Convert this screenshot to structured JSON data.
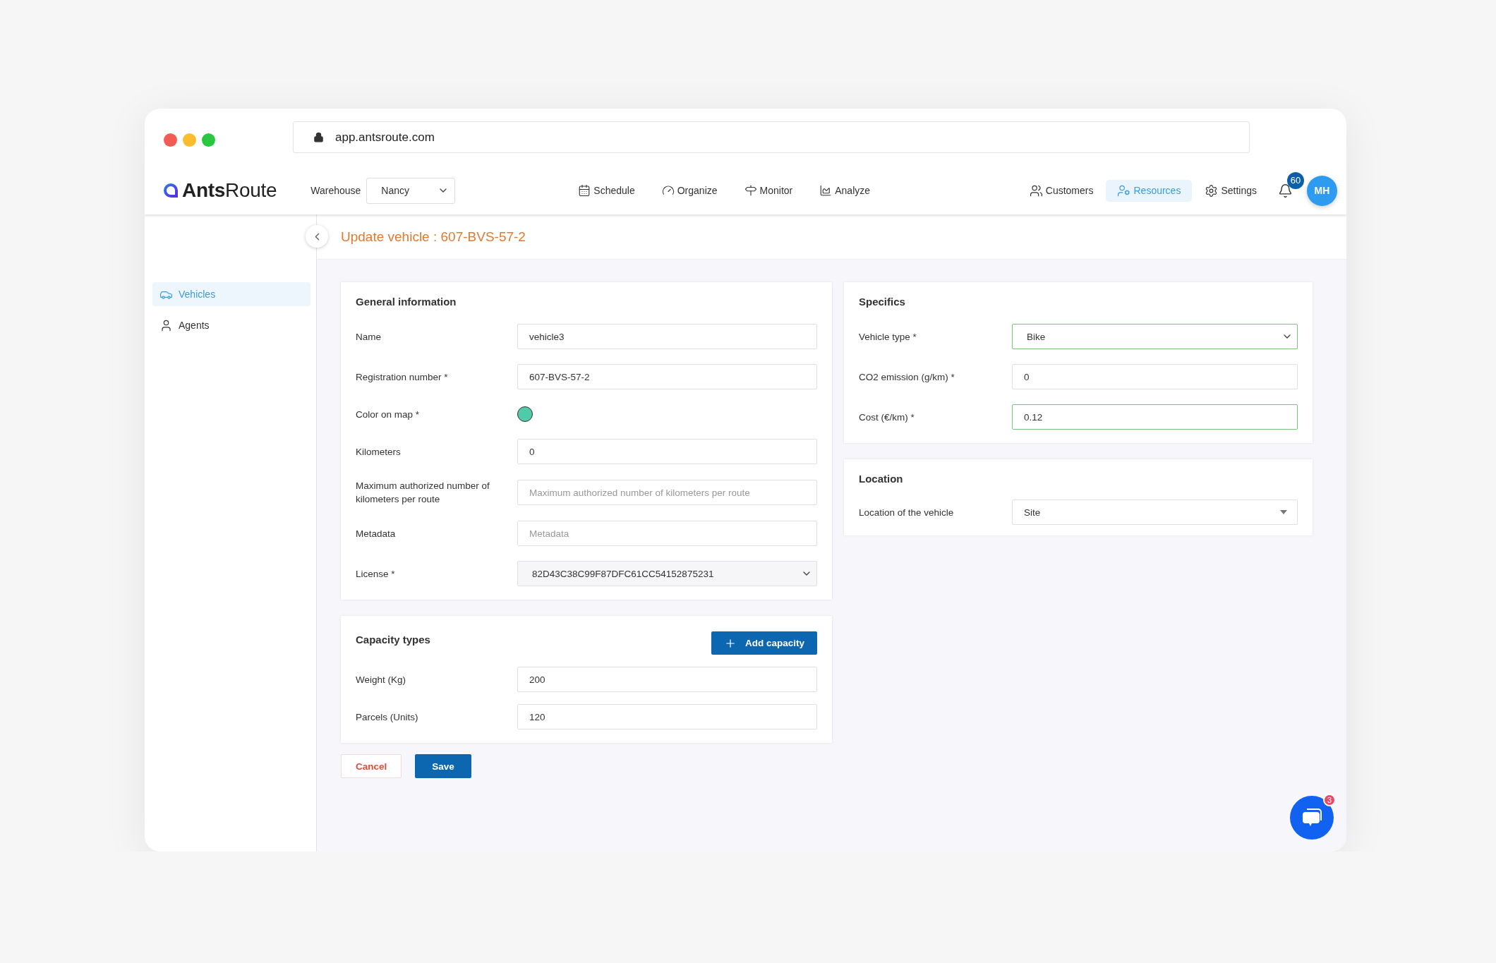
{
  "browser": {
    "url": "app.antsroute.com"
  },
  "nav": {
    "logo": {
      "bold": "Ants",
      "light": "Route"
    },
    "warehouse": {
      "label": "Warehouse",
      "value": "Nancy"
    },
    "items": [
      {
        "label": "Schedule",
        "selected": false
      },
      {
        "label": "Organize",
        "selected": false
      },
      {
        "label": "Monitor",
        "selected": false
      },
      {
        "label": "Analyze",
        "selected": false
      }
    ],
    "right_items": [
      {
        "label": "Customers",
        "selected": false
      },
      {
        "label": "Resources",
        "selected": true
      },
      {
        "label": "Settings",
        "selected": false
      }
    ],
    "notifications": "60",
    "avatar": "MH"
  },
  "sidebar": {
    "items": [
      {
        "label": "Vehicles",
        "selected": true
      },
      {
        "label": "Agents",
        "selected": false
      }
    ]
  },
  "page_title": "Update vehicle : 607-BVS-57-2",
  "general": {
    "title": "General information",
    "fields": [
      {
        "kind": "input",
        "label": "Name",
        "value": "vehicle3"
      },
      {
        "kind": "input",
        "label": "Registration number *",
        "value": "607-BVS-57-2"
      },
      {
        "kind": "color",
        "label": "Color on map *",
        "color": "#4fcba9"
      },
      {
        "kind": "input",
        "label": "Kilometers",
        "value": "0"
      },
      {
        "kind": "input",
        "label": "Maximum authorized number of kilometers per route",
        "placeholder": "Maximum authorized number of kilometers per route"
      },
      {
        "kind": "input",
        "label": "Metadata",
        "placeholder": "Metadata"
      },
      {
        "kind": "select",
        "label": "License *",
        "value": "82D43C38C99F87DFC61CC54152875231"
      }
    ]
  },
  "capacity": {
    "title": "Capacity types",
    "add_button": "Add capacity",
    "fields": [
      {
        "kind": "input",
        "label": "Weight (Kg)",
        "value": "200"
      },
      {
        "kind": "input",
        "label": "Parcels (Units)",
        "value": "120"
      }
    ]
  },
  "actions": {
    "cancel": "Cancel",
    "save": "Save"
  },
  "specifics": {
    "title": "Specifics",
    "fields": [
      {
        "kind": "select",
        "label": "Vehicle type *",
        "value": "Bike",
        "valid": true
      },
      {
        "kind": "input",
        "label": "CO2 emission (g/km) *",
        "value": "0",
        "valid": false
      },
      {
        "kind": "input",
        "label": "Cost (€/km) *",
        "value": "0.12",
        "valid": true
      }
    ]
  },
  "location": {
    "title": "Location",
    "fields": [
      {
        "kind": "dropdown",
        "label": "Location of the vehicle",
        "value": "Site"
      }
    ]
  },
  "chat": {
    "badge": "3"
  }
}
